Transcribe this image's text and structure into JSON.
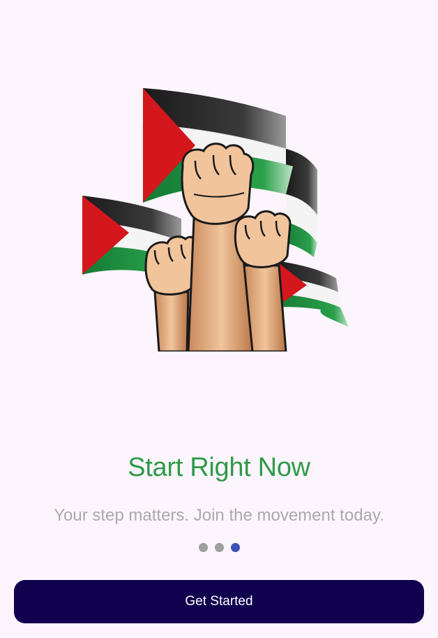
{
  "onboarding": {
    "title": "Start Right Now",
    "subtitle": "Your step matters. Join the movement today.",
    "page_indicator": {
      "total": 3,
      "active": 3
    },
    "cta_label": "Get Started",
    "illustration_icon": "raised-fists-with-palestine-flags"
  },
  "colors": {
    "background": "#fdf5fd",
    "title": "#2e9a48",
    "subtitle": "#a9a9a9",
    "dot_inactive": "#9e9e9e",
    "dot_active": "#3f51b5",
    "button": "#10004e",
    "button_text": "#ffffff"
  }
}
